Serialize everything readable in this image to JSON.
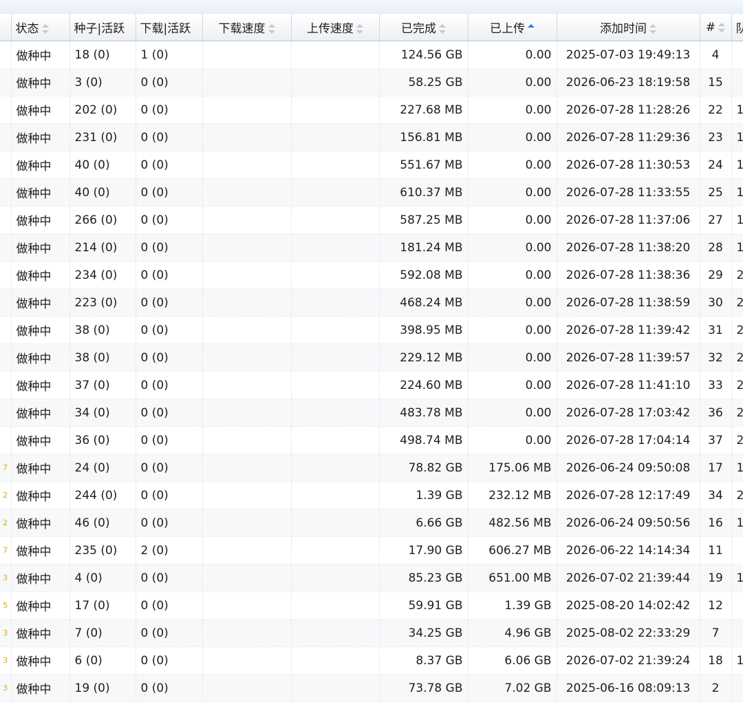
{
  "header": {
    "status": "状态",
    "seeds": "种子|活跃",
    "peers": "下载|活跃",
    "dl_speed": "下载速度",
    "ul_speed": "上传速度",
    "done": "已完成",
    "uploaded": "已上传",
    "added": "添加时间",
    "index": "#",
    "next": "队"
  },
  "rows": [
    {
      "status": "做种中",
      "seeds": "18 (0)",
      "peers": "1 (0)",
      "done": "124.56 GB",
      "uploaded": "0.00",
      "added": "2025-07-03 19:49:13",
      "index": "4",
      "edge": "",
      "next": ""
    },
    {
      "status": "做种中",
      "seeds": "3 (0)",
      "peers": "0 (0)",
      "done": "58.25 GB",
      "uploaded": "0.00",
      "added": "2026-06-23 18:19:58",
      "index": "15",
      "edge": "",
      "next": ""
    },
    {
      "status": "做种中",
      "seeds": "202 (0)",
      "peers": "0 (0)",
      "done": "227.68 MB",
      "uploaded": "0.00",
      "added": "2026-07-28 11:28:26",
      "index": "22",
      "edge": "",
      "next": "1"
    },
    {
      "status": "做种中",
      "seeds": "231 (0)",
      "peers": "0 (0)",
      "done": "156.81 MB",
      "uploaded": "0.00",
      "added": "2026-07-28 11:29:36",
      "index": "23",
      "edge": "",
      "next": "1"
    },
    {
      "status": "做种中",
      "seeds": "40 (0)",
      "peers": "0 (0)",
      "done": "551.67 MB",
      "uploaded": "0.00",
      "added": "2026-07-28 11:30:53",
      "index": "24",
      "edge": "",
      "next": "1"
    },
    {
      "status": "做种中",
      "seeds": "40 (0)",
      "peers": "0 (0)",
      "done": "610.37 MB",
      "uploaded": "0.00",
      "added": "2026-07-28 11:33:55",
      "index": "25",
      "edge": "",
      "next": "1"
    },
    {
      "status": "做种中",
      "seeds": "266 (0)",
      "peers": "0 (0)",
      "done": "587.25 MB",
      "uploaded": "0.00",
      "added": "2026-07-28 11:37:06",
      "index": "27",
      "edge": "",
      "next": "1"
    },
    {
      "status": "做种中",
      "seeds": "214 (0)",
      "peers": "0 (0)",
      "done": "181.24 MB",
      "uploaded": "0.00",
      "added": "2026-07-28 11:38:20",
      "index": "28",
      "edge": "",
      "next": "1"
    },
    {
      "status": "做种中",
      "seeds": "234 (0)",
      "peers": "0 (0)",
      "done": "592.08 MB",
      "uploaded": "0.00",
      "added": "2026-07-28 11:38:36",
      "index": "29",
      "edge": "",
      "next": "2"
    },
    {
      "status": "做种中",
      "seeds": "223 (0)",
      "peers": "0 (0)",
      "done": "468.24 MB",
      "uploaded": "0.00",
      "added": "2026-07-28 11:38:59",
      "index": "30",
      "edge": "",
      "next": "2"
    },
    {
      "status": "做种中",
      "seeds": "38 (0)",
      "peers": "0 (0)",
      "done": "398.95 MB",
      "uploaded": "0.00",
      "added": "2026-07-28 11:39:42",
      "index": "31",
      "edge": "",
      "next": "2"
    },
    {
      "status": "做种中",
      "seeds": "38 (0)",
      "peers": "0 (0)",
      "done": "229.12 MB",
      "uploaded": "0.00",
      "added": "2026-07-28 11:39:57",
      "index": "32",
      "edge": "",
      "next": "2"
    },
    {
      "status": "做种中",
      "seeds": "37 (0)",
      "peers": "0 (0)",
      "done": "224.60 MB",
      "uploaded": "0.00",
      "added": "2026-07-28 11:41:10",
      "index": "33",
      "edge": "",
      "next": "2"
    },
    {
      "status": "做种中",
      "seeds": "34 (0)",
      "peers": "0 (0)",
      "done": "483.78 MB",
      "uploaded": "0.00",
      "added": "2026-07-28 17:03:42",
      "index": "36",
      "edge": "",
      "next": "2"
    },
    {
      "status": "做种中",
      "seeds": "36 (0)",
      "peers": "0 (0)",
      "done": "498.74 MB",
      "uploaded": "0.00",
      "added": "2026-07-28 17:04:14",
      "index": "37",
      "edge": "",
      "next": "2"
    },
    {
      "status": "做种中",
      "seeds": "24 (0)",
      "peers": "0 (0)",
      "done": "78.82 GB",
      "uploaded": "175.06 MB",
      "added": "2026-06-24 09:50:08",
      "index": "17",
      "edge": "7",
      "next": "1"
    },
    {
      "status": "做种中",
      "seeds": "244 (0)",
      "peers": "0 (0)",
      "done": "1.39 GB",
      "uploaded": "232.12 MB",
      "added": "2026-07-28 12:17:49",
      "index": "34",
      "edge": "2",
      "next": "2"
    },
    {
      "status": "做种中",
      "seeds": "46 (0)",
      "peers": "0 (0)",
      "done": "6.66 GB",
      "uploaded": "482.56 MB",
      "added": "2026-06-24 09:50:56",
      "index": "16",
      "edge": "2",
      "next": "1"
    },
    {
      "status": "做种中",
      "seeds": "235 (0)",
      "peers": "2 (0)",
      "done": "17.90 GB",
      "uploaded": "606.27 MB",
      "added": "2026-06-22 14:14:34",
      "index": "11",
      "edge": "7",
      "next": ""
    },
    {
      "status": "做种中",
      "seeds": "4 (0)",
      "peers": "0 (0)",
      "done": "85.23 GB",
      "uploaded": "651.00 MB",
      "added": "2026-07-02 21:39:44",
      "index": "19",
      "edge": "3",
      "next": "1"
    },
    {
      "status": "做种中",
      "seeds": "17 (0)",
      "peers": "0 (0)",
      "done": "59.91 GB",
      "uploaded": "1.39 GB",
      "added": "2025-08-20 14:02:42",
      "index": "12",
      "edge": "5",
      "next": ""
    },
    {
      "status": "做种中",
      "seeds": "7 (0)",
      "peers": "0 (0)",
      "done": "34.25 GB",
      "uploaded": "4.96 GB",
      "added": "2025-08-02 22:33:29",
      "index": "7",
      "edge": "3",
      "next": ""
    },
    {
      "status": "做种中",
      "seeds": "6 (0)",
      "peers": "0 (0)",
      "done": "8.37 GB",
      "uploaded": "6.06 GB",
      "added": "2026-07-02 21:39:24",
      "index": "18",
      "edge": "3",
      "next": "1"
    },
    {
      "status": "做种中",
      "seeds": "19 (0)",
      "peers": "0 (0)",
      "done": "73.78 GB",
      "uploaded": "7.02 GB",
      "added": "2025-06-16 08:09:13",
      "index": "2",
      "edge": "3",
      "next": ""
    }
  ]
}
